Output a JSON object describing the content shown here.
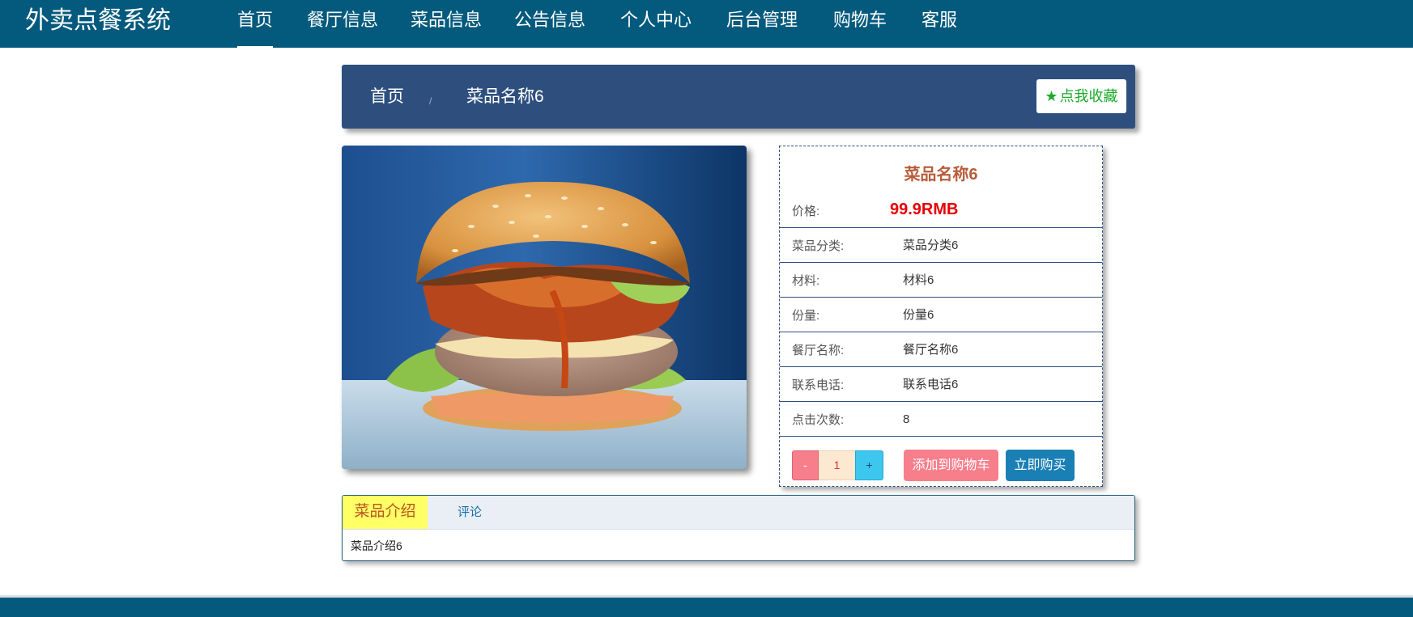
{
  "brand": "外卖点餐系统",
  "nav": {
    "items": [
      "首页",
      "餐厅信息",
      "菜品信息",
      "公告信息",
      "个人中心",
      "后台管理",
      "购物车",
      "客服"
    ],
    "active": "首页"
  },
  "breadcrumb": {
    "home": "首页",
    "separator": "/",
    "current": "菜品名称6",
    "favorite_icon": "star-icon",
    "favorite_label": "点我收藏"
  },
  "product": {
    "name": "菜品名称6",
    "image": "burger-photo",
    "price_label": "价格:",
    "price": "99.9RMB",
    "details": [
      {
        "label": "菜品分类:",
        "value": "菜品分类6"
      },
      {
        "label": "材料:",
        "value": "材料6"
      },
      {
        "label": "份量:",
        "value": "份量6"
      },
      {
        "label": "餐厅名称:",
        "value": "餐厅名称6"
      },
      {
        "label": "联系电话:",
        "value": "联系电话6"
      },
      {
        "label": "点击次数:",
        "value": "8"
      }
    ],
    "quantity": {
      "minus": "-",
      "value": "1",
      "plus": "+"
    },
    "add_to_cart": "添加到购物车",
    "buy_now": "立即购买"
  },
  "tabs": {
    "items": [
      "菜品介绍",
      "评论"
    ],
    "active": "菜品介绍",
    "content": "菜品介绍6"
  },
  "colors": {
    "nav_bg": "#035a7d",
    "breadcrumb_bg": "#2e4f7e",
    "price": "#e60000",
    "title": "#b85c3a",
    "add_cart_bg": "#f77f8c",
    "buy_now_bg": "#1a7fb5",
    "active_tab_bg": "#ffff66"
  }
}
